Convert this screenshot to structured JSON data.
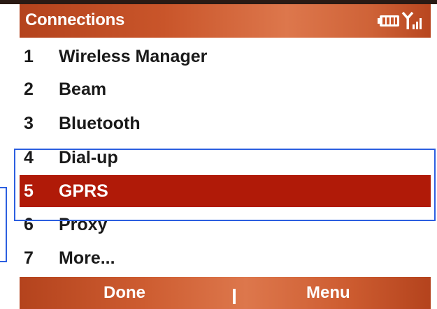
{
  "title_bar": {
    "title": "Connections",
    "battery_icon": "battery-icon",
    "signal_icon": "signal-strength-icon"
  },
  "menu": {
    "items": [
      {
        "number": "1",
        "label": "Wireless Manager"
      },
      {
        "number": "2",
        "label": "Beam"
      },
      {
        "number": "3",
        "label": "Bluetooth"
      },
      {
        "number": "4",
        "label": "Dial-up"
      },
      {
        "number": "5",
        "label": "GPRS",
        "selected": true
      },
      {
        "number": "6",
        "label": "Proxy"
      },
      {
        "number": "7",
        "label": "More..."
      }
    ]
  },
  "softkeys": {
    "left": "Done",
    "right": "Menu"
  },
  "colors": {
    "title_bar": "#c9552a",
    "selection": "#b01a08",
    "annotation_box": "#2c5fe0"
  }
}
